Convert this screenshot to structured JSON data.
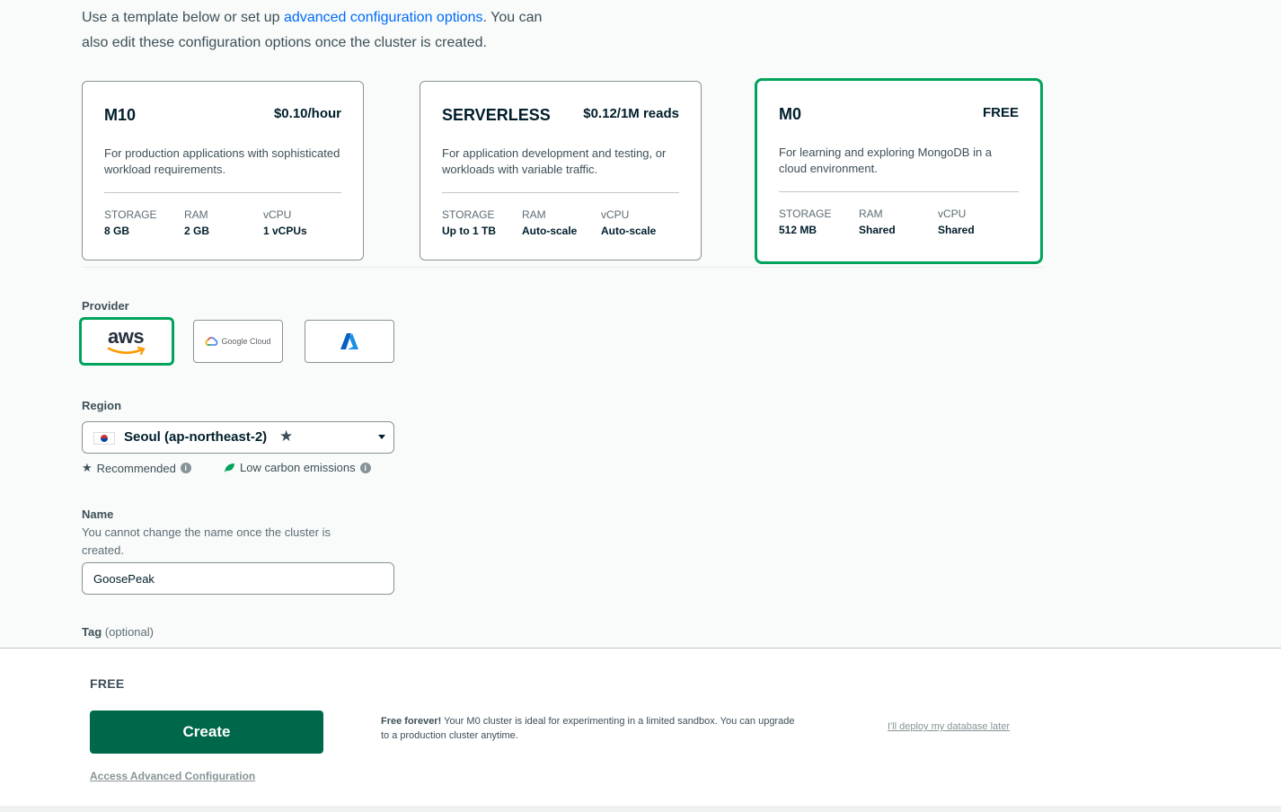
{
  "intro": {
    "before": "Use a template below or set up ",
    "link": "advanced configuration options",
    "after": ". You can also edit these configuration options once the cluster is created."
  },
  "tiers": [
    {
      "name": "M10",
      "price": "$0.10/hour",
      "description": "For production applications with sophisticated workload requirements.",
      "specs": [
        {
          "key": "STORAGE",
          "value": "8 GB"
        },
        {
          "key": "RAM",
          "value": "2 GB"
        },
        {
          "key": "vCPU",
          "value": "1 vCPUs"
        }
      ]
    },
    {
      "name": "SERVERLESS",
      "price": "$0.12/1M reads",
      "description": "For application development and testing, or workloads with variable traffic.",
      "specs": [
        {
          "key": "STORAGE",
          "value": "Up to 1 TB"
        },
        {
          "key": "RAM",
          "value": "Auto-scale"
        },
        {
          "key": "vCPU",
          "value": "Auto-scale"
        }
      ]
    },
    {
      "name": "M0",
      "price": "FREE",
      "selected": true,
      "description": "For learning and exploring MongoDB in a cloud environment.",
      "specs": [
        {
          "key": "STORAGE",
          "value": "512 MB"
        },
        {
          "key": "RAM",
          "value": "Shared"
        },
        {
          "key": "vCPU",
          "value": "Shared"
        }
      ]
    }
  ],
  "provider": {
    "label": "Provider",
    "options": [
      {
        "icon": "aws-logo-icon",
        "text": "aws",
        "selected": true
      },
      {
        "icon": "google-cloud-logo-icon",
        "text": "Google Cloud",
        "selected": false
      },
      {
        "icon": "azure-logo-icon",
        "text": "",
        "selected": false
      }
    ]
  },
  "region": {
    "label": "Region",
    "selected": "Seoul (ap-northeast-2)",
    "icon": "south-korea-flag-icon",
    "legend": {
      "recommended": "Recommended",
      "low_carbon": "Low carbon emissions"
    }
  },
  "name": {
    "label": "Name",
    "help": "You cannot change the name once the cluster is created.",
    "value": "GoosePeak"
  },
  "tag": {
    "label": "Tag",
    "optional": "(optional)"
  },
  "footer": {
    "tier": "FREE",
    "create_label": "Create",
    "advanced_link": "Access Advanced Configuration",
    "note_bold": "Free forever!",
    "note_rest": " Your M0 cluster is ideal for experimenting in a limited sandbox. You can upgrade to a production cluster anytime.",
    "deploy_later": "I'll deploy my database later"
  },
  "colors": {
    "brand_green": "#00684a",
    "selected_border": "#00a35c",
    "link_blue": "#016bf8"
  }
}
